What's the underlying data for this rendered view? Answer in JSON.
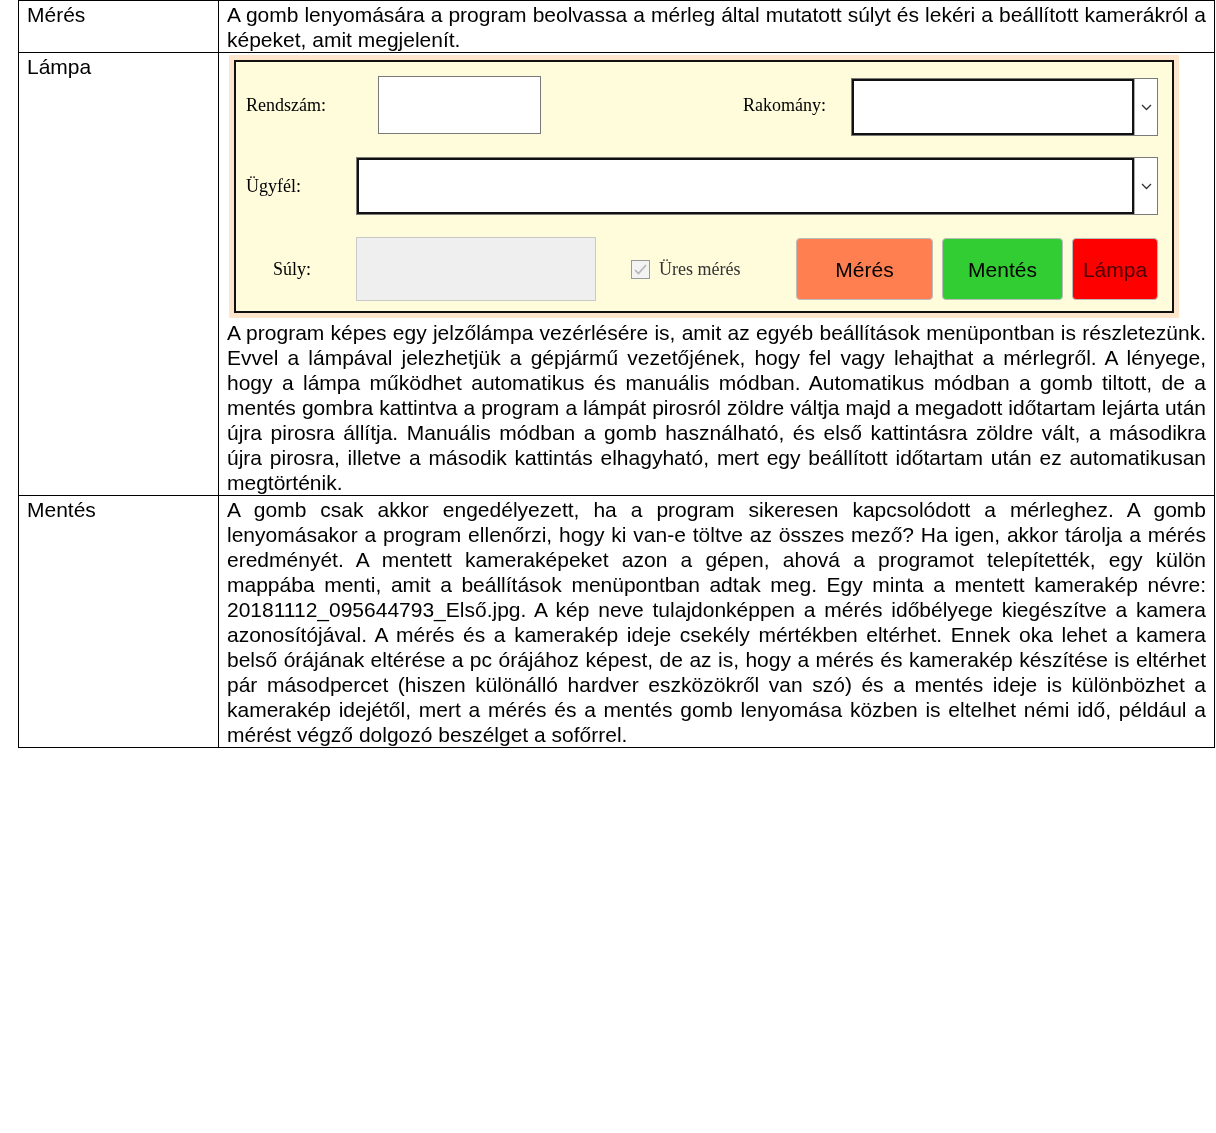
{
  "rows": [
    {
      "label": "Mérés",
      "paragraphs": [
        [
          {
            "text": "A gomb lenyomására a program beolvassa a mérleg által mutatott súlyt és lekéri a beállított kamerákról a képeket, amit megjelenít."
          }
        ]
      ]
    },
    {
      "label": "Lámpa",
      "form": {
        "rendszam": {
          "label": "Rendszám:"
        },
        "rakomany": {
          "label": "Rakomány:"
        },
        "ugyfel": {
          "label": "Ügyfél:"
        },
        "suly": {
          "label": "Súly:",
          "disabled": true
        },
        "checkbox": {
          "label": "Üres mérés",
          "checked": true,
          "disabled": true
        },
        "buttons": [
          {
            "label": "Mérés",
            "color": "#ff7f50",
            "disabled": false
          },
          {
            "label": "Mentés",
            "color": "#32cd32",
            "disabled": false
          },
          {
            "label": "Lámpa",
            "color": "#ff0000",
            "disabled": true
          }
        ]
      },
      "paragraphs": [
        [
          {
            "text": "A program képes egy jelzőlámpa vezérlésére is, amit az "
          },
          {
            "link": "egyéb beállítások"
          },
          {
            "text": " menüpontban is részletezünk. Evvel a lámpával jelezhetjük a gépjármű vezetőjének, hogy fel vagy lehajthat a mérlegről. A lényege, hogy a lámpa működhet automatikus és manuális módban. Automatikus módban a gomb tiltott, de a mentés gombra kattintva a program a lámpát pirosról zöldre váltja majd a megadott időtartam lejárta után újra pirosra állítja. Manuális módban a gomb használható, és első kattintásra zöldre vált, a másodikra újra pirosra, illetve a második kattintás elhagyható, mert egy beállított időtartam után ez automatikusan megtörténik."
          }
        ]
      ]
    },
    {
      "label": "Mentés",
      "paragraphs": [
        [
          {
            "text": "A gomb csak akkor engedélyezett, ha a program sikeresen kapcsolódott a mérleghez. A gomb lenyomásakor a program ellenőrzi, hogy ki van-e töltve az összes mező? Ha igen, akkor tárolja a mérés eredményét.  A mentett kameraképeket azon a gépen, ahová a programot telepítették, egy külön mappába menti, amit a "
          },
          {
            "link": "beállítások"
          },
          {
            "text": " menüpontban adtak meg. Egy minta a mentett kamerakép névre: 20181112_095644793_Első.jpg. A kép neve tulajdonképpen a mérés időbélyege kiegészítve a kamera azonosítójával. A mérés és a kamerakép ideje csekély mértékben eltérhet. Ennek oka lehet a kamera belső órájának eltérése a pc órájához képest, de az is, hogy a mérés és kamerakép készítése is eltérhet pár másodpercet (hiszen különálló hardver eszközökről van szó) és a mentés ideje is különbözhet a kamerakép idejétől, mert a mérés és a mentés gomb lenyomása közben is eltelhet némi idő, például a mérést végző dolgozó beszélget a sofőrrel."
          }
        ]
      ]
    }
  ]
}
